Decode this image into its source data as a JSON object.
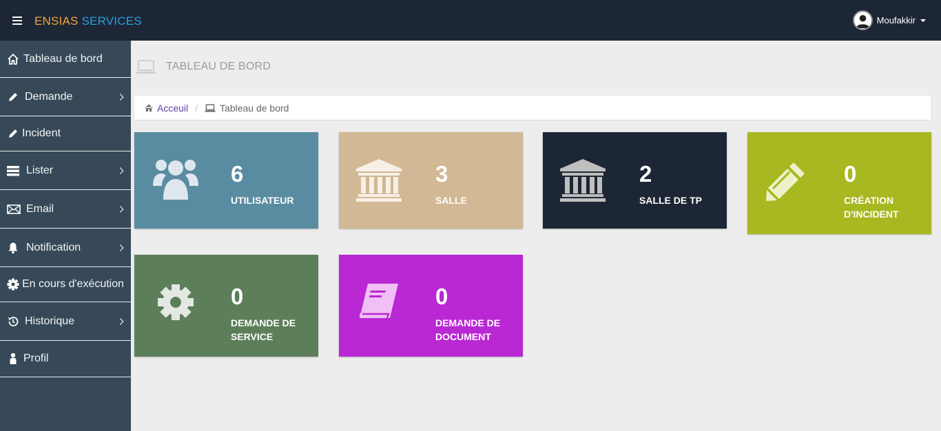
{
  "header": {
    "brand_part1": "ENSIAS",
    "brand_part2": "SERVICES",
    "user_name": "Moufakkir"
  },
  "sidebar": {
    "items": [
      {
        "label": "Tableau de bord",
        "icon": "home-icon",
        "has_submenu": false
      },
      {
        "label": "Demande",
        "icon": "pencil-icon",
        "has_submenu": true
      },
      {
        "label": "Incident",
        "icon": "pencil-icon",
        "has_submenu": false
      },
      {
        "label": "Lister",
        "icon": "list-icon",
        "has_submenu": true
      },
      {
        "label": "Email",
        "icon": "envelope-icon",
        "has_submenu": true
      },
      {
        "label": "Notification",
        "icon": "bell-icon",
        "has_submenu": true
      },
      {
        "label": "En cours d'exécution",
        "icon": "gear-icon",
        "has_submenu": false
      },
      {
        "label": "Historique",
        "icon": "history-icon",
        "has_submenu": true
      },
      {
        "label": "Profil",
        "icon": "user-icon",
        "has_submenu": false
      }
    ]
  },
  "page": {
    "title": "TABLEAU DE BORD"
  },
  "breadcrumb": {
    "home": "Acceuil",
    "current": "Tableau de bord"
  },
  "cards": [
    {
      "count": "6",
      "label": "UTILISATEUR",
      "color": "#5a8ca1",
      "icon": "users-icon"
    },
    {
      "count": "3",
      "label": "SALLE",
      "color": "#d2b895",
      "icon": "bank-icon"
    },
    {
      "count": "2",
      "label": "SALLE DE TP",
      "color": "#1d2635",
      "icon": "bank-icon"
    },
    {
      "count": "0",
      "label": "CRÉATION D'INCIDENT",
      "color": "#a8b820",
      "icon": "pencil-icon"
    },
    {
      "count": "0",
      "label": "DEMANDE DE SERVICE",
      "color": "#5c7f5a",
      "icon": "gear-icon"
    },
    {
      "count": "0",
      "label": "DEMANDE DE DOCUMENT",
      "color": "#b928d3",
      "icon": "book-icon"
    }
  ]
}
